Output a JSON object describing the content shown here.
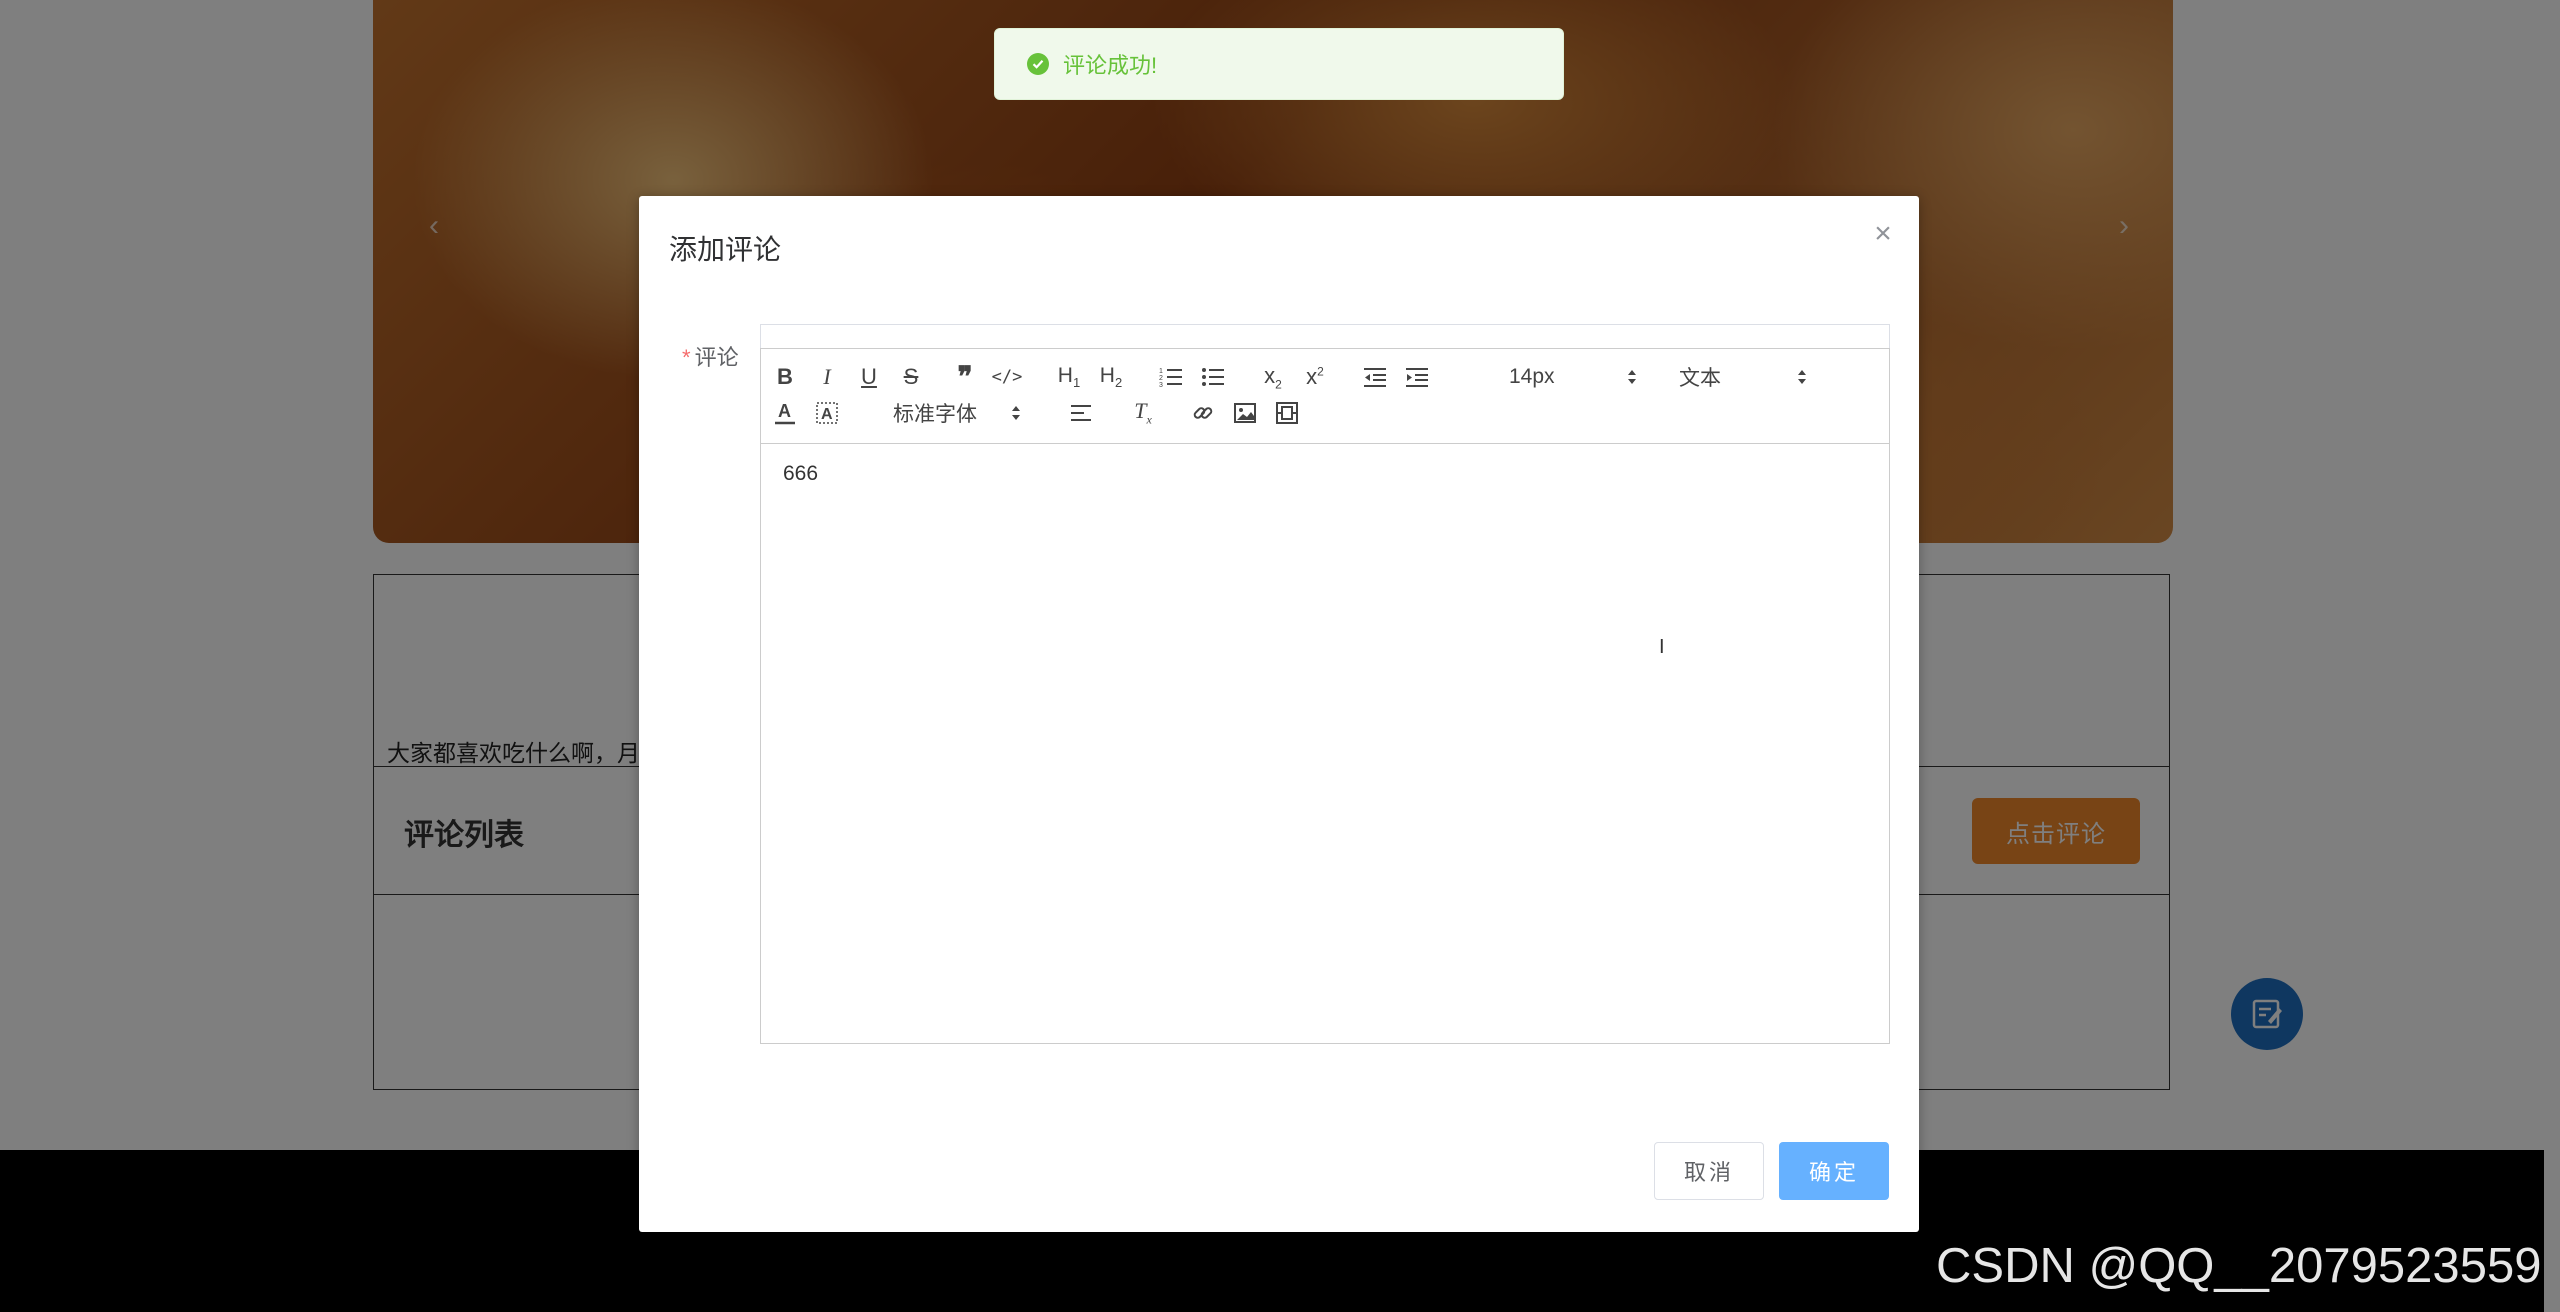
{
  "toast": {
    "message": "评论成功!",
    "type": "success",
    "icon": "check-circle-icon",
    "color": "#67c23a"
  },
  "page": {
    "carousel": {
      "prev_icon": "chevron-left-icon",
      "next_icon": "chevron-right-icon"
    },
    "topic_text": "大家都喜欢吃什么啊，月",
    "comment_list_title": "评论列表",
    "comment_button": "点击评论",
    "float_button_icon": "edit-note-icon",
    "accent_color": "#f0882b"
  },
  "dialog": {
    "title": "添加评论",
    "close_icon": "close-icon",
    "field_label": "评论",
    "required_mark": "*",
    "editor": {
      "toolbar": {
        "font_size": "14px",
        "header": "文本",
        "font_family": "标准字体",
        "buttons": [
          "bold",
          "italic",
          "underline",
          "strike",
          "blockquote",
          "code-block",
          "header-1",
          "header-2",
          "ordered-list",
          "bullet-list",
          "subscript",
          "superscript",
          "outdent",
          "indent",
          "text-color",
          "background-color",
          "align",
          "clean",
          "link",
          "image",
          "video"
        ]
      },
      "content": "666"
    },
    "cancel_label": "取消",
    "confirm_label": "确定",
    "primary_color": "#66b1ff"
  },
  "watermark": "CSDN @QQ__2079523559"
}
